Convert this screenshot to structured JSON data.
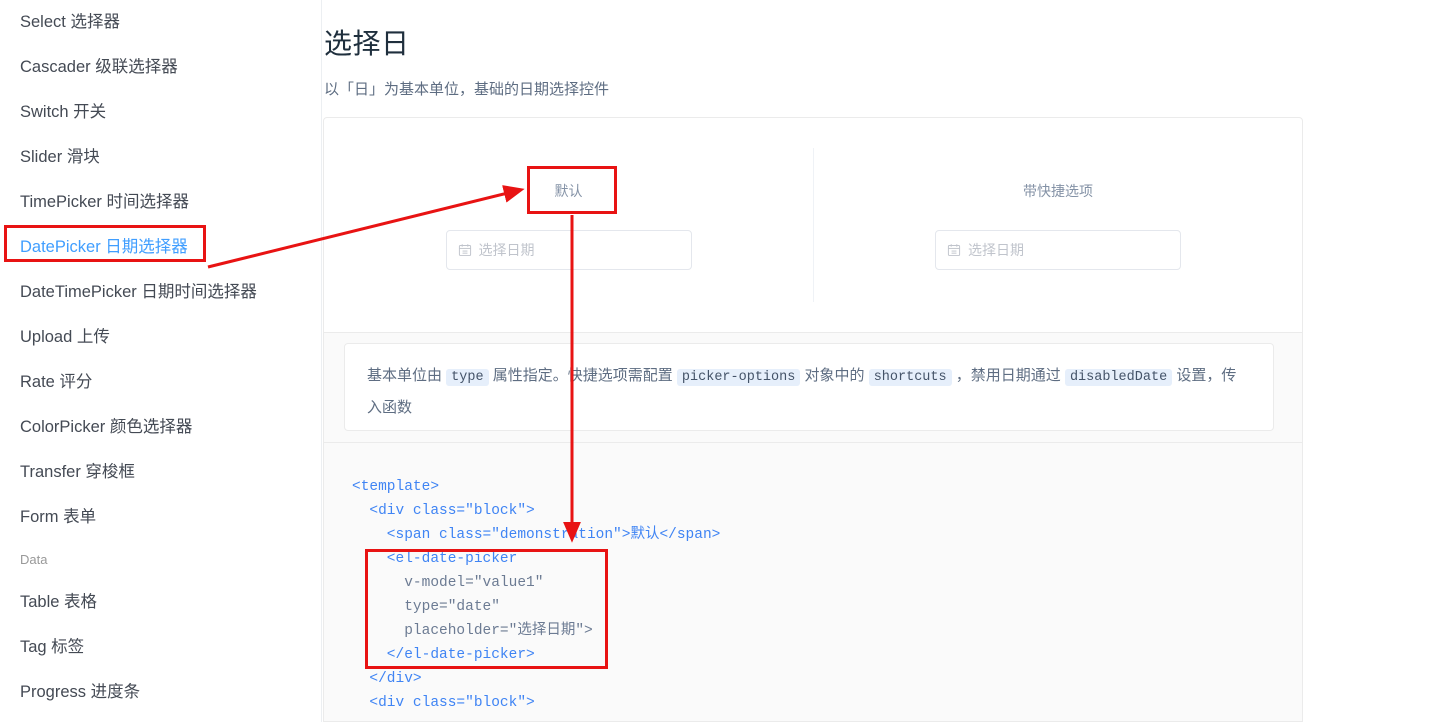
{
  "sidebar": {
    "items": [
      {
        "label": "Select 选择器",
        "type": "link",
        "active": false
      },
      {
        "label": "Cascader 级联选择器",
        "type": "link",
        "active": false
      },
      {
        "label": "Switch 开关",
        "type": "link",
        "active": false
      },
      {
        "label": "Slider 滑块",
        "type": "link",
        "active": false
      },
      {
        "label": "TimePicker 时间选择器",
        "type": "link",
        "active": false
      },
      {
        "label": "DatePicker 日期选择器",
        "type": "link",
        "active": true
      },
      {
        "label": "DateTimePicker 日期时间选择器",
        "type": "link",
        "active": false
      },
      {
        "label": "Upload 上传",
        "type": "link",
        "active": false
      },
      {
        "label": "Rate 评分",
        "type": "link",
        "active": false
      },
      {
        "label": "ColorPicker 颜色选择器",
        "type": "link",
        "active": false
      },
      {
        "label": "Transfer 穿梭框",
        "type": "link",
        "active": false
      },
      {
        "label": "Form 表单",
        "type": "link",
        "active": false
      },
      {
        "label": "Data",
        "type": "group",
        "active": false
      },
      {
        "label": "Table 表格",
        "type": "link",
        "active": false
      },
      {
        "label": "Tag 标签",
        "type": "link",
        "active": false
      },
      {
        "label": "Progress 进度条",
        "type": "link",
        "active": false
      }
    ]
  },
  "main": {
    "title": "选择日",
    "description": "以「日」为基本单位，基础的日期选择控件",
    "demos": [
      {
        "label": "默认",
        "input_placeholder": "选择日期",
        "icon": "calendar-icon"
      },
      {
        "label": "带快捷选项",
        "input_placeholder": "选择日期",
        "icon": "calendar-icon"
      }
    ],
    "usage": {
      "part1": "基本单位由 ",
      "code1": "type",
      "part2": " 属性指定。快捷选项需配置 ",
      "code2": "picker-options",
      "part3": " 对象中的 ",
      "code3": "shortcuts",
      "part4": " ，禁用日期通过 ",
      "code4": "disabledDate",
      "part5": " 设置，传入函数"
    },
    "code_sample": {
      "line1_tag_open": "<template>",
      "line2": "  <div class=\"block\">",
      "line3": "    <span class=\"demonstration\">默认</span>",
      "line4": "    <el-date-picker",
      "line5": "      v-model=\"value1\"",
      "line6": "      type=\"date\"",
      "line7": "      placeholder=\"选择日期\">",
      "line8": "    </el-date-picker>",
      "line9": "  </div>",
      "line10": "  <div class=\"block\">"
    }
  },
  "annotations": {
    "color": "#e81313",
    "boxes": [
      {
        "name": "sidebar-datepicker-highlight",
        "target": "DatePicker 日期选择器"
      },
      {
        "name": "default-label-highlight",
        "target": "默认"
      },
      {
        "name": "code-el-date-picker-highlight",
        "target": "<el-date-picker ... </el-date-picker>"
      }
    ],
    "arrows": [
      {
        "name": "arrow-sidebar-to-default-label",
        "from": "DatePicker 日期选择器",
        "to": "默认"
      },
      {
        "name": "arrow-default-label-to-code",
        "from": "默认",
        "to": "<span class=\"demonstration\">默认</span>"
      }
    ]
  },
  "colors": {
    "accent": "#409EFF",
    "annotation": "#e81313",
    "title": "#1f2f3d",
    "body_text": "#5e6d82",
    "placeholder": "#c0c4cc",
    "code_bg": "#fafafa",
    "inline_code_bg": "#e6effb"
  }
}
